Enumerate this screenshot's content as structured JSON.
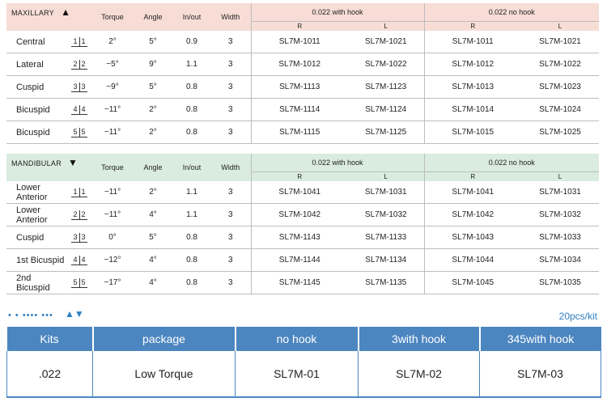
{
  "columns": {
    "torque": "Torque",
    "angle": "Angle",
    "inout": "In/out",
    "width": "Width",
    "hook": "0.022 with hook",
    "nohook": "0.022 no hook",
    "r": "R",
    "l": "L"
  },
  "maxillary": {
    "title": "MAXILLARY",
    "arrow": "▲",
    "rows": [
      {
        "name": "Central",
        "tooth": [
          "1",
          "1"
        ],
        "torque": "2°",
        "angle": "5°",
        "inout": "0.9",
        "width": "3",
        "hook_r": "SL7M-1011",
        "hook_l": "SL7M-1021",
        "nohook_r": "SL7M-1011",
        "nohook_l": "SL7M-1021"
      },
      {
        "name": "Lateral",
        "tooth": [
          "2",
          "2"
        ],
        "torque": "−5°",
        "angle": "9°",
        "inout": "1.1",
        "width": "3",
        "hook_r": "SL7M-1012",
        "hook_l": "SL7M-1022",
        "nohook_r": "SL7M-1012",
        "nohook_l": "SL7M-1022"
      },
      {
        "name": "Cuspid",
        "tooth": [
          "3",
          "3"
        ],
        "torque": "−9°",
        "angle": "5°",
        "inout": "0.8",
        "width": "3",
        "hook_r": "SL7M-1113",
        "hook_l": "SL7M-1123",
        "nohook_r": "SL7M-1013",
        "nohook_l": "SL7M-1023"
      },
      {
        "name": "Bicuspid",
        "tooth": [
          "4",
          "4"
        ],
        "torque": "−11°",
        "angle": "2°",
        "inout": "0.8",
        "width": "3",
        "hook_r": "SL7M-1114",
        "hook_l": "SL7M-1124",
        "nohook_r": "SL7M-1014",
        "nohook_l": "SL7M-1024"
      },
      {
        "name": "Bicuspid",
        "tooth": [
          "5",
          "5"
        ],
        "torque": "−11°",
        "angle": "2°",
        "inout": "0.8",
        "width": "3",
        "hook_r": "SL7M-1115",
        "hook_l": "SL7M-1125",
        "nohook_r": "SL7M-1015",
        "nohook_l": "SL7M-1025"
      }
    ]
  },
  "mandibular": {
    "title": "MANDIBULAR",
    "arrow": "▼",
    "rows": [
      {
        "name": "Lower Anterior",
        "tooth": [
          "1",
          "1"
        ],
        "torque": "−11°",
        "angle": "2°",
        "inout": "1.1",
        "width": "3",
        "hook_r": "SL7M-1041",
        "hook_l": "SL7M-1031",
        "nohook_r": "SL7M-1041",
        "nohook_l": "SL7M-1031"
      },
      {
        "name": "Lower Anterior",
        "tooth": [
          "2",
          "2"
        ],
        "torque": "−11°",
        "angle": "4°",
        "inout": "1.1",
        "width": "3",
        "hook_r": "SL7M-1042",
        "hook_l": "SL7M-1032",
        "nohook_r": "SL7M-1042",
        "nohook_l": "SL7M-1032"
      },
      {
        "name": "Cuspid",
        "tooth": [
          "3",
          "3"
        ],
        "torque": "0°",
        "angle": "5°",
        "inout": "0.8",
        "width": "3",
        "hook_r": "SL7M-1143",
        "hook_l": "SL7M-1133",
        "nohook_r": "SL7M-1043",
        "nohook_l": "SL7M-1033"
      },
      {
        "name": "1st Bicuspid",
        "tooth": [
          "4",
          "4"
        ],
        "torque": "−12°",
        "angle": "4°",
        "inout": "0.8",
        "width": "3",
        "hook_r": "SL7M-1144",
        "hook_l": "SL7M-1134",
        "nohook_r": "SL7M-1044",
        "nohook_l": "SL7M-1034"
      },
      {
        "name": "2nd Bicuspid",
        "tooth": [
          "5",
          "5"
        ],
        "torque": "−17°",
        "angle": "4°",
        "inout": "0.8",
        "width": "3",
        "hook_r": "SL7M-1145",
        "hook_l": "SL7M-1135",
        "nohook_r": "SL7M-1045",
        "nohook_l": "SL7M-1035"
      }
    ]
  },
  "decor": {
    "dots": "• • •••• •••",
    "arrows": "▲▼",
    "pcs": "20pcs/kit"
  },
  "kits": {
    "headers": [
      "Kits",
      "package",
      "no hook",
      "3with hook",
      "345with hook"
    ],
    "row": [
      ".022",
      "Low Torque",
      "SL7M-01",
      "SL7M-02",
      "SL7M-03"
    ]
  }
}
